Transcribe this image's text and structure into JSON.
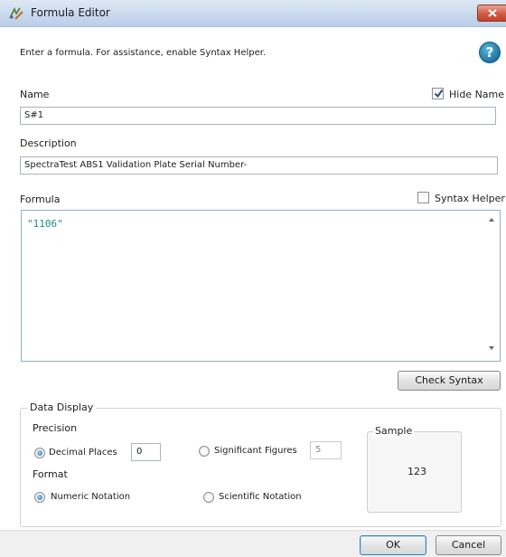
{
  "window": {
    "title": "Formula Editor"
  },
  "instructions": "Enter a formula. For assistance, enable Syntax Helper.",
  "name": {
    "label": "Name",
    "value": "S#1",
    "hide_name_label": "Hide Name",
    "hide_name_checked": true
  },
  "description": {
    "label": "Description",
    "value": "SpectraTest ABS1 Validation Plate Serial Number-"
  },
  "formula": {
    "label": "Formula",
    "value": "\"1106\"",
    "syntax_helper_label": "Syntax Helper",
    "syntax_helper_checked": false
  },
  "check_syntax_label": "Check Syntax",
  "data_display": {
    "title": "Data Display",
    "precision_label": "Precision",
    "decimal_places_label": "Decimal Places",
    "decimal_places_value": "0",
    "significant_figures_label": "Significant Figures",
    "significant_figures_value": "5",
    "format_label": "Format",
    "numeric_notation_label": "Numeric Notation",
    "scientific_notation_label": "Scientific Notation",
    "sample_label": "Sample",
    "sample_value": "123"
  },
  "footer": {
    "ok_label": "OK",
    "cancel_label": "Cancel"
  },
  "colors": {
    "formula_text": "#1a8d8b",
    "title_bar": "#c7d8ed",
    "close_button": "#d05b43",
    "help_icon": "#1c6f9c"
  }
}
